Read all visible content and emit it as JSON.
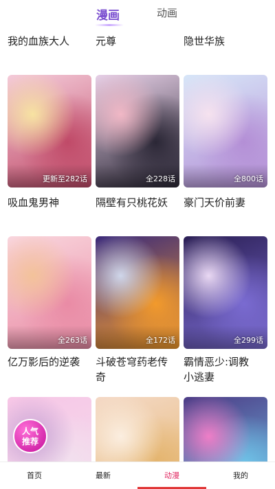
{
  "top_tabs": {
    "manhua": "漫画",
    "donghua": "动画"
  },
  "rows": [
    {
      "titles": [
        "我的血族大人",
        "元尊",
        "隐世华族"
      ]
    },
    {
      "cards": [
        {
          "count": "更新至282话",
          "palette": [
            "#f4cbd9",
            "#c04a68",
            "#f7e3a2"
          ]
        },
        {
          "count": "全228话",
          "palette": [
            "#e7d0e7",
            "#2b2736",
            "#f1b8c6"
          ]
        },
        {
          "count": "全800话",
          "palette": [
            "#d7e6f8",
            "#b48fd6",
            "#f6e2ef"
          ]
        }
      ],
      "titles": [
        [
          "吸血鬼男神"
        ],
        [
          "隔壁有只桃花妖"
        ],
        [
          "豪门天价前妻"
        ]
      ]
    },
    {
      "cards": [
        {
          "count": "全263话",
          "palette": [
            "#f9d6dd",
            "#e98ba5",
            "#f3c29a"
          ]
        },
        {
          "count": "全172话",
          "palette": [
            "#3b2a7a",
            "#f29a2c",
            "#cfd6ea"
          ]
        },
        {
          "count": "全299话",
          "palette": [
            "#2b1f55",
            "#7a6bd1",
            "#e9d8f3"
          ]
        }
      ],
      "titles": [
        [
          "亿万影后的逆袭"
        ],
        [
          "斗破苍穹药老传",
          "奇"
        ],
        [
          "霸情恶少:调教",
          "小逃妻"
        ]
      ]
    },
    {
      "cards": [
        {
          "count": "",
          "palette": [
            "#f7c6e6",
            "#f2e0ee",
            "#c7a3d4"
          ],
          "badge": [
            "人气",
            "推荐"
          ]
        },
        {
          "count": "",
          "palette": [
            "#f4d9c6",
            "#e4b46d",
            "#fbeee0"
          ]
        },
        {
          "count": "",
          "palette": [
            "#4d3c86",
            "#6fc3e8",
            "#ee7ec7"
          ]
        }
      ]
    }
  ],
  "bottom_nav": {
    "items": [
      {
        "label": "首页"
      },
      {
        "label": "最新"
      },
      {
        "label": "动漫"
      },
      {
        "label": "我的"
      }
    ],
    "active_index": 2,
    "active_color": "#e03535"
  }
}
